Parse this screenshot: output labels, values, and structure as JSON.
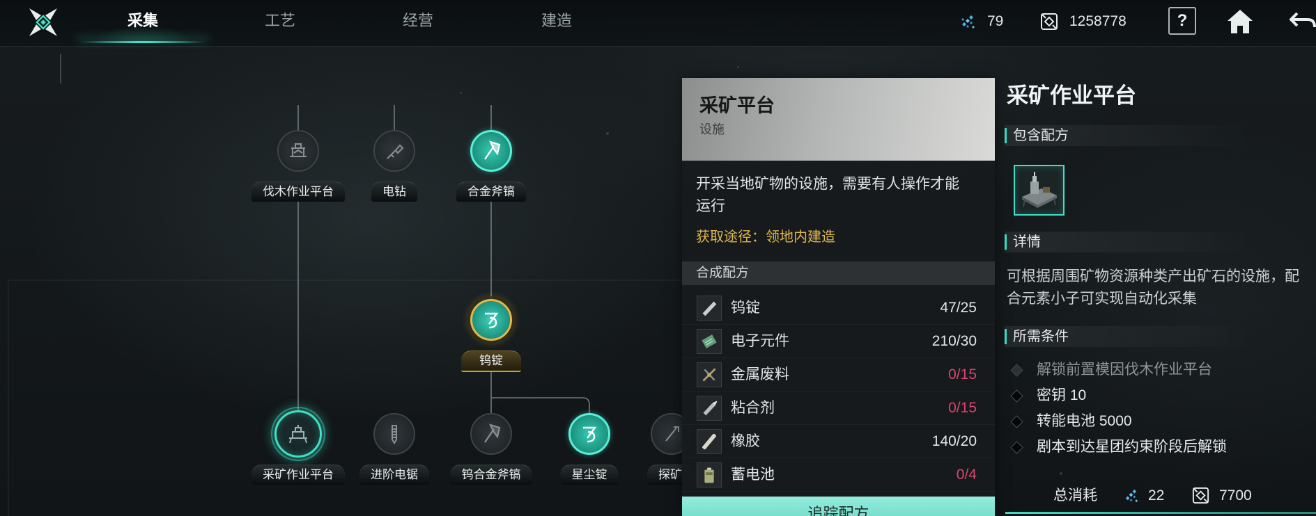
{
  "header": {
    "logo_icon": "game-logo-icon",
    "tabs": [
      {
        "label": "采集",
        "active": true
      },
      {
        "label": "工艺",
        "active": false
      },
      {
        "label": "经营",
        "active": false
      },
      {
        "label": "建造",
        "active": false
      }
    ],
    "resources": [
      {
        "icon": "crystal-icon",
        "value": "79"
      },
      {
        "icon": "cube-currency-icon",
        "value": "1258778"
      }
    ],
    "help_label": "?",
    "home_icon": "home-icon",
    "back_icon": "back-arrow-icon"
  },
  "tree": {
    "nodes": [
      {
        "label": "伐木作业平台",
        "icon": "lumber-platform-icon",
        "state": "locked"
      },
      {
        "label": "电钻",
        "icon": "drill-icon",
        "state": "locked"
      },
      {
        "label": "合金斧镐",
        "icon": "alloy-axe-pick-icon",
        "state": "unlocked"
      },
      {
        "label": "钨锭",
        "icon": "tungsten-ingot-icon",
        "state": "focused"
      },
      {
        "label": "采矿作业平台",
        "icon": "mining-platform-icon",
        "state": "selected"
      },
      {
        "label": "进阶电锯",
        "icon": "chainsaw-icon",
        "state": "locked"
      },
      {
        "label": "钨合金斧镐",
        "icon": "tungsten-axe-pick-icon",
        "state": "locked"
      },
      {
        "label": "星尘锭",
        "icon": "stardust-ingot-icon",
        "state": "unlocked"
      },
      {
        "label": "探矿",
        "icon": "prospecting-icon",
        "state": "locked"
      }
    ]
  },
  "card": {
    "title": "采矿平台",
    "subtitle": "设施",
    "description": "开采当地矿物的设施，需要有人操作才能运行",
    "source": "获取途径：领地内建造",
    "recipe_header": "合成配方",
    "materials": [
      {
        "name": "钨锭",
        "count": "47/25",
        "icon": "tungsten-ingot-icon"
      },
      {
        "name": "电子元件",
        "count": "210/30",
        "icon": "circuit-board-icon"
      },
      {
        "name": "金属废料",
        "count": "0/15",
        "icon": "metal-scrap-icon"
      },
      {
        "name": "粘合剂",
        "count": "0/15",
        "icon": "adhesive-icon"
      },
      {
        "name": "橡胶",
        "count": "140/20",
        "icon": "rubber-icon"
      },
      {
        "name": "蓄电池",
        "count": "0/4",
        "icon": "battery-icon"
      }
    ],
    "track_button": "追踪配方"
  },
  "info": {
    "title": "采矿作业平台",
    "recipes_header": "包含配方",
    "recipe_icon": "mining-platform-icon",
    "details_header": "详情",
    "details_lines": [
      "可根据周围矿物资源种类产出矿石的设施，配",
      "合元素小子可实现自动化采集"
    ],
    "requirements_header": "所需条件",
    "requirements": [
      {
        "text": "解锁前置模因伐木作业平台",
        "dimmed": true
      },
      {
        "text": "密钥 10",
        "dimmed": false
      },
      {
        "text": "转能电池 5000",
        "dimmed": false
      },
      {
        "text": "剧本到达星团约束阶段后解锁",
        "dimmed": false
      }
    ],
    "total_cost_label": "总消耗",
    "costs": [
      {
        "icon": "crystal-icon",
        "value": "22"
      },
      {
        "icon": "cube-currency-icon",
        "value": "7700"
      }
    ]
  },
  "colors": {
    "accent": "#3ee0c6",
    "gold": "#e2b84b",
    "insufficient": "#d8466e",
    "text": "#e6eaea",
    "muted": "#8d9596",
    "background": "#161b1d"
  }
}
